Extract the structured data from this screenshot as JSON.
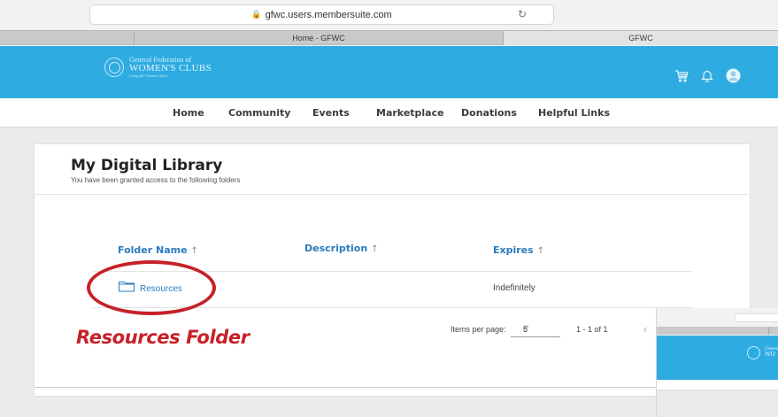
{
  "browser": {
    "url": "gfwc.users.membersuite.com",
    "tabs": [
      "Home - GFWC",
      "GFWC"
    ]
  },
  "header": {
    "logo": {
      "line1": "General Federation of",
      "line2": "WOMEN'S CLUBS",
      "line3": "Living the Volunteer Spirit"
    },
    "icons": [
      "cart-icon",
      "bell-icon",
      "user-avatar-icon"
    ],
    "brand_color": "#2eace2"
  },
  "nav": {
    "items": [
      "Home",
      "Community",
      "Events",
      "Marketplace",
      "Donations",
      "Helpful Links"
    ]
  },
  "library": {
    "title": "My Digital Library",
    "subtitle": "You have been granted access to the following folders",
    "columns": [
      "Folder Name",
      "Description",
      "Expires"
    ],
    "rows": [
      {
        "folder_name": "Resources",
        "description": "",
        "expires": "Indefinitely"
      }
    ],
    "pagination": {
      "items_per_page_label": "Items per page:",
      "items_per_page_value": "5",
      "range": "1 - 1 of 1"
    }
  },
  "annotation": {
    "label": "Resources Folder",
    "color": "#c62128"
  }
}
